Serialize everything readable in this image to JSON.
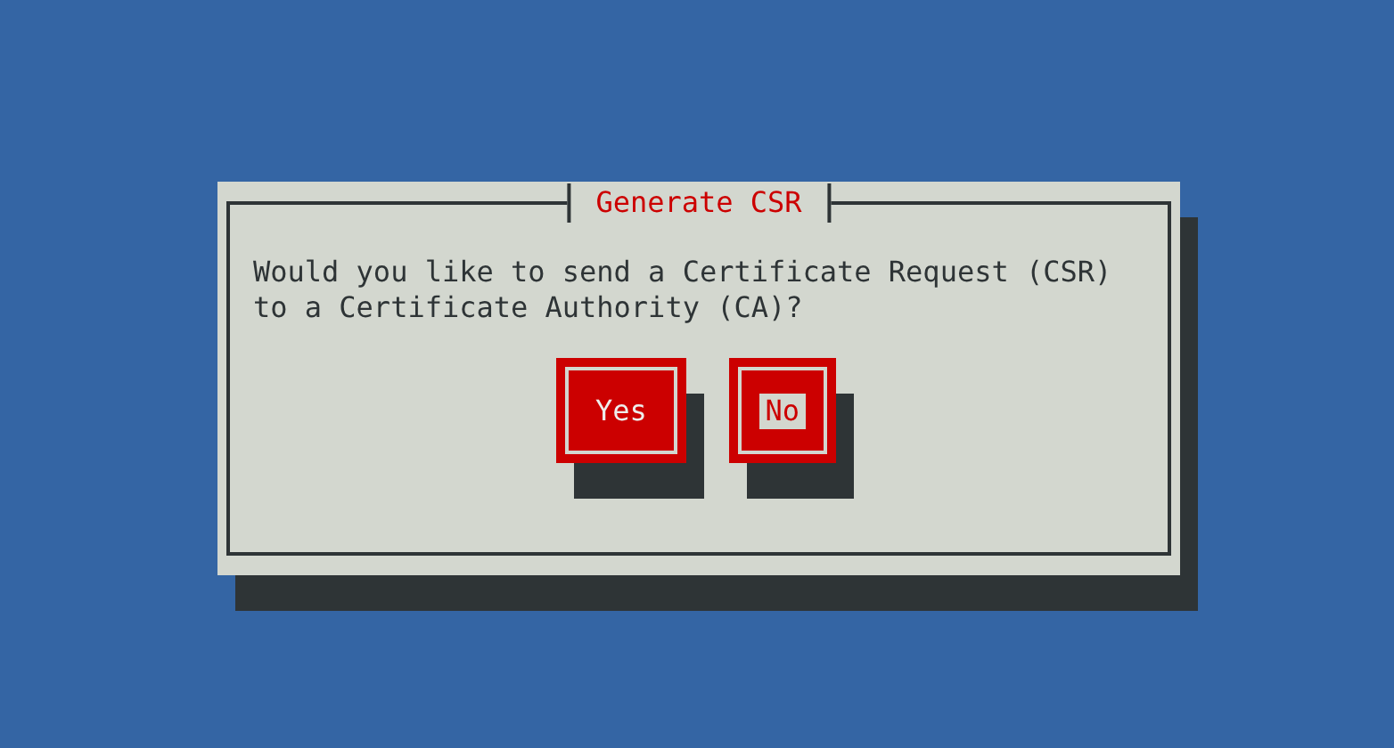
{
  "dialog": {
    "title": "Generate CSR",
    "message_lines": [
      "Would you like to send a Certificate Request (CSR)",
      "to a Certificate Authority (CA)?"
    ],
    "buttons": [
      {
        "label": "Yes",
        "selected": false
      },
      {
        "label": "No",
        "selected": true
      }
    ]
  }
}
